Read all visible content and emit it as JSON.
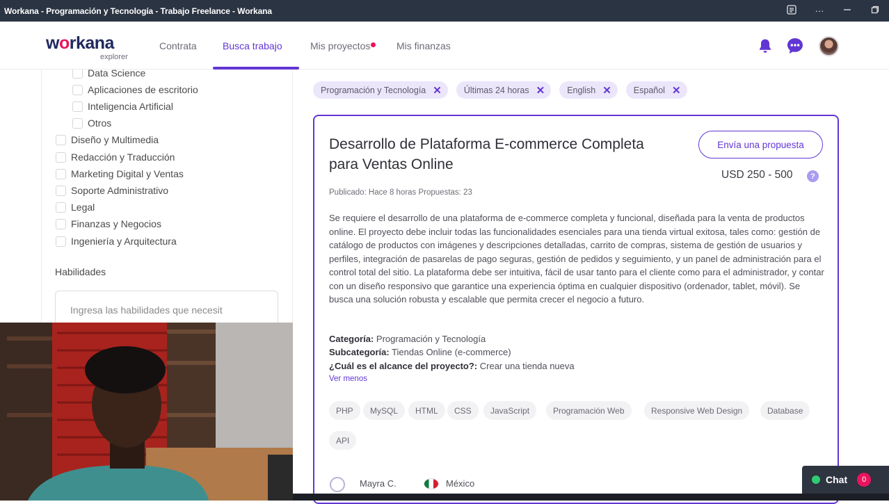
{
  "window": {
    "title": "Workana - Programación y Tecnología - Trabajo Freelance - Workana",
    "more_label": "···"
  },
  "header": {
    "logo_text_pre": "w",
    "logo_text_o": "o",
    "logo_text_post": "rkana",
    "logo_sub": "explorer",
    "nav": [
      {
        "label": "Contrata",
        "active": false
      },
      {
        "label": "Busca trabajo",
        "active": true
      },
      {
        "label": "Mis proyectos",
        "active": false,
        "dot": true
      },
      {
        "label": "Mis finanzas",
        "active": false
      }
    ],
    "icons": [
      "bell-icon",
      "chat-bubble-icon",
      "avatar"
    ]
  },
  "sidebar": {
    "subcategories": [
      "Data Science",
      "Aplicaciones de escritorio",
      "Inteligencia Artificial",
      "Otros"
    ],
    "categories": [
      "Diseño y Multimedia",
      "Redacción y Traducción",
      "Marketing Digital y Ventas",
      "Soporte Administrativo",
      "Legal",
      "Finanzas y Negocios",
      "Ingeniería y Arquitectura"
    ],
    "skills_title": "Habilidades",
    "skills_placeholder": "Ingresa las habilidades que necesit"
  },
  "filters": [
    "Programación y Tecnología",
    "Últimas 24 horas",
    "English",
    "Español"
  ],
  "project": {
    "title": "Desarrollo de Plataforma E-commerce Completa para Ventas Online",
    "propose_label": "Envía una propuesta",
    "price": "USD 250 - 500",
    "help": "?",
    "meta": "Publicado: Hace 8 horas   Propuestas: 23",
    "description": "Se requiere el desarrollo de una plataforma de e-commerce completa y funcional, diseñada para la venta de productos online. El proyecto debe incluir todas las funcionalidades esenciales para una tienda virtual exitosa, tales como: gestión de catálogo de productos con imágenes y descripciones detalladas, carrito de compras, sistema de gestión de usuarios y perfiles, integración de pasarelas de pago seguras, gestión de pedidos y seguimiento, y un panel de administración para el control total del sitio. La plataforma debe ser intuitiva, fácil de usar tanto para el cliente como para el administrador, y contar con un diseño responsivo que garantice una experiencia óptima en cualquier dispositivo (ordenador, tablet, móvil). Se busca una solución robusta y escalable que permita crecer el negocio a futuro.",
    "category_label": "Categoría:",
    "category_value": " Programación y Tecnología",
    "subcategory_label": "Subcategoría:",
    "subcategory_value": " Tiendas Online (e-commerce)",
    "scope_label": "¿Cuál es el alcance del proyecto?:",
    "scope_value": " Crear una tienda nueva",
    "ver_menos": "Ver menos",
    "skills": [
      "PHP",
      "MySQL",
      "HTML",
      "CSS",
      "JavaScript",
      "Programación Web",
      "Responsive Web Design",
      "Database",
      "API"
    ],
    "author": "Mayra C.",
    "country": "México"
  },
  "chat": {
    "label": "Chat",
    "count": "0"
  }
}
